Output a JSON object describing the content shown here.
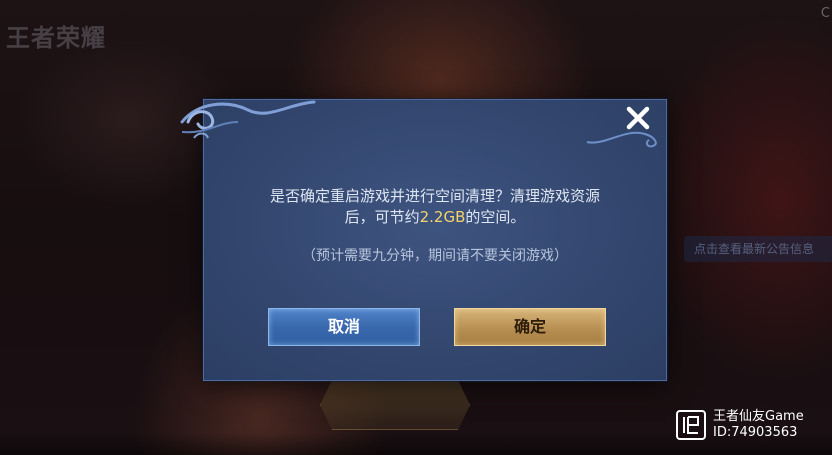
{
  "background": {
    "game_logo": "王者荣耀",
    "corner_text": "C",
    "announcement_label": "点击查看最新公告信息"
  },
  "dialog": {
    "message_line1": "是否确定重启游戏并进行空间清理？清理游戏资源",
    "message_line2_prefix": "后，可节约",
    "message_highlight": "2.2GB",
    "message_line2_suffix": "的空间。",
    "hint": "（预计需要九分钟，期间请不要关闭游戏）",
    "cancel_label": "取消",
    "confirm_label": "确定",
    "highlight_color": "#f3d36a"
  },
  "icons": {
    "close": "close-icon",
    "watermark": "watermark-logo-icon"
  },
  "watermark": {
    "line1": "王者仙友Game",
    "line2": "ID:74903563"
  }
}
